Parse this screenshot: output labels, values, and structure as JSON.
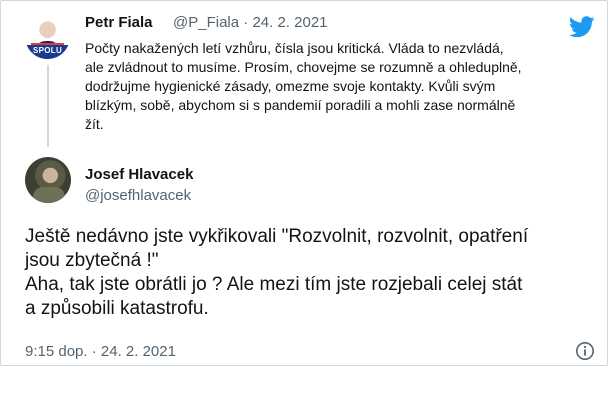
{
  "parent_tweet": {
    "author_name": "Petr Fiala",
    "handle": "@P_Fiala",
    "separator": "·",
    "date": "24. 2. 2021",
    "avatar_label": "SPOLU",
    "text_lines": [
      "Počty nakažených letí vzhůru, čísla jsou kritická. Vláda to nezvládá,",
      "ale zvládnout to musíme. Prosím, chovejme se rozumně a ohleduplně,",
      "dodržujme hygienické zásady, omezme svoje kontakty. Kvůli svým",
      "blízkým, sobě, abychom si s pandemií poradili a mohli zase normálně",
      "žít."
    ]
  },
  "main_tweet": {
    "author_name": "Josef Hlavacek",
    "handle": "@josefhlavacek",
    "text_lines": [
      "Ještě nedávno jste vykřikovali \"Rozvolnit, rozvolnit, opatření",
      "jsou zbytečná !\"",
      "Aha, tak jste obrátli jo ? Ale mezi tím jste rozjebali celej stát",
      "a způsobili katastrofu."
    ],
    "timestamp": "9:15 dop. · 24. 2. 2021"
  },
  "icons": {
    "brand": "twitter-bird-icon",
    "info": "info-icon"
  },
  "colors": {
    "twitter_blue": "#1d9bf0",
    "secondary_text": "#536471",
    "primary_text": "#0f1419",
    "border": "#cfd9de"
  }
}
